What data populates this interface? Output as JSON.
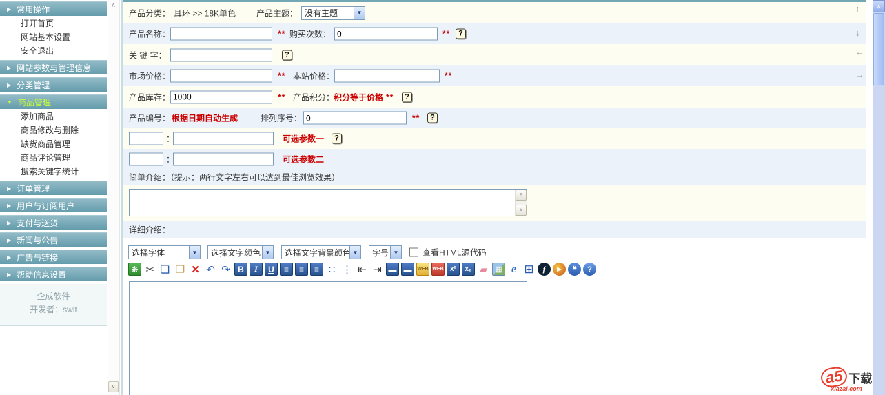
{
  "sidebar": {
    "headers": [
      "常用操作",
      "网站参数与管理信息",
      "分类管理",
      "商品管理",
      "订单管理",
      "用户与订阅用户",
      "支付与送货",
      "新闻与公告",
      "广告与链接",
      "帮助信息设置"
    ],
    "common_items": [
      "打开首页",
      "网站基本设置",
      "安全退出"
    ],
    "product_items": [
      "添加商品",
      "商品修改与删除",
      "缺货商品管理",
      "商品评论管理",
      "搜索关键字统计"
    ],
    "footer_brand": "企成软件",
    "footer_dev": "开发者：swit"
  },
  "form": {
    "category_label": "产品分类：",
    "category_value": "耳环 >> 18K单色",
    "theme_label": "产品主题：",
    "theme_value": "没有主题",
    "name_label": "产品名称：",
    "name_value": "",
    "required_mark": "**",
    "buy_label": "购买次数：",
    "buy_value": "0",
    "keyword_label": "关 键 字：",
    "keyword_value": "",
    "market_label": "市场价格：",
    "market_value": "",
    "site_label": "本站价格：",
    "site_value": "",
    "stock_label": "产品库存：",
    "stock_value": "1000",
    "points_label": "产品积分：",
    "points_note": "积分等于价格",
    "code_label": "产品编号：",
    "code_note": "根据日期自动生成",
    "order_label": "排列序号：",
    "order_value": "0",
    "colon": "：",
    "param1_value": "",
    "param1_name_value": "",
    "param1_note": "可选参数一",
    "param2_value": "",
    "param2_name_value": "",
    "param2_note": "可选参数二",
    "brief_label": "简单介绍：（提示：两行文字左右可以达到最佳浏览效果）",
    "brief_value": "",
    "detail_label": "详细介绍："
  },
  "editor": {
    "font_select": "选择字体",
    "color_select": "选择文字颜色",
    "bgcolor_select": "选择文字背景颜色",
    "size_select": "字号",
    "html_checkbox_label": "查看HTML源代码",
    "toolbar_icons": [
      {
        "name": "plugin-icon",
        "glyph": "❋",
        "cls": "ic-green"
      },
      {
        "name": "cut-icon",
        "glyph": "✂",
        "cls": "ic-plain"
      },
      {
        "name": "copy-icon",
        "glyph": "❏",
        "cls": "ic-plain ic-blueink"
      },
      {
        "name": "paste-icon",
        "glyph": "❐",
        "cls": "ic-plain ic-tan"
      },
      {
        "name": "delete-icon",
        "glyph": "✕",
        "cls": "ic-plain ic-red"
      },
      {
        "name": "undo-icon",
        "glyph": "↶",
        "cls": "ic-plain ic-blueink"
      },
      {
        "name": "redo-icon",
        "glyph": "↷",
        "cls": "ic-plain ic-blueink"
      },
      {
        "name": "bold-icon",
        "glyph": "B",
        "cls": "ic-sq"
      },
      {
        "name": "italic-icon",
        "glyph": "I",
        "cls": "ic-sq ic-it"
      },
      {
        "name": "underline-icon",
        "glyph": "U",
        "cls": "ic-sq ic-ul"
      },
      {
        "name": "align-left-icon",
        "glyph": "≡",
        "cls": "ic-sq"
      },
      {
        "name": "align-center-icon",
        "glyph": "≡",
        "cls": "ic-sq"
      },
      {
        "name": "align-right-icon",
        "glyph": "≡",
        "cls": "ic-sq"
      },
      {
        "name": "bullet-list-icon",
        "glyph": "∷",
        "cls": "ic-plain ic-blueink"
      },
      {
        "name": "numbered-list-icon",
        "glyph": "⋮",
        "cls": "ic-plain ic-blueink"
      },
      {
        "name": "outdent-icon",
        "glyph": "⇤",
        "cls": "ic-plain ic-dark"
      },
      {
        "name": "indent-icon",
        "glyph": "⇥",
        "cls": "ic-plain ic-dark"
      },
      {
        "name": "horizontal-rule-icon",
        "glyph": "▬",
        "cls": "ic-sq"
      },
      {
        "name": "horizontal-rule-2-icon",
        "glyph": "▬",
        "cls": "ic-sq"
      },
      {
        "name": "web-link-icon",
        "glyph": "WEB",
        "cls": "ic-web"
      },
      {
        "name": "web-unlink-icon",
        "glyph": "WEB",
        "cls": "ic-web ic-web-red"
      },
      {
        "name": "superscript-icon",
        "glyph": "x²",
        "cls": "ic-sq ic-small"
      },
      {
        "name": "subscript-icon",
        "glyph": "x₂",
        "cls": "ic-sq ic-small"
      },
      {
        "name": "eraser-icon",
        "glyph": "▰",
        "cls": "ic-plain ic-pink"
      },
      {
        "name": "insert-image-icon",
        "glyph": "▦",
        "cls": "ic-img"
      },
      {
        "name": "browser-icon",
        "glyph": "e",
        "cls": "ic-plain ic-ie"
      },
      {
        "name": "table-icon",
        "glyph": "⊞",
        "cls": "ic-plain ic-blueink ic-big"
      },
      {
        "name": "flash-icon",
        "glyph": "f",
        "cls": "ic-circle ic-flash"
      },
      {
        "name": "media-icon",
        "glyph": "▶",
        "cls": "ic-circle ic-media"
      },
      {
        "name": "comment-icon",
        "glyph": "❝",
        "cls": "ic-circle ic-comment"
      },
      {
        "name": "help-icon",
        "glyph": "?",
        "cls": "ic-circle ic-help"
      }
    ]
  },
  "ui": {
    "collapsed_arrow": "▶",
    "expanded_arrow": "▼",
    "select_arrow": "▼",
    "help_glyph": "?",
    "scroll_up_glyph": "∧",
    "scroll_down_glyph": "∨",
    "arrow_up": "↑",
    "arrow_down": "↓",
    "arrow_left": "←",
    "arrow_right": "→"
  },
  "watermark": {
    "a5": "a5",
    "download": "下载",
    "site": "xiazai.com"
  }
}
